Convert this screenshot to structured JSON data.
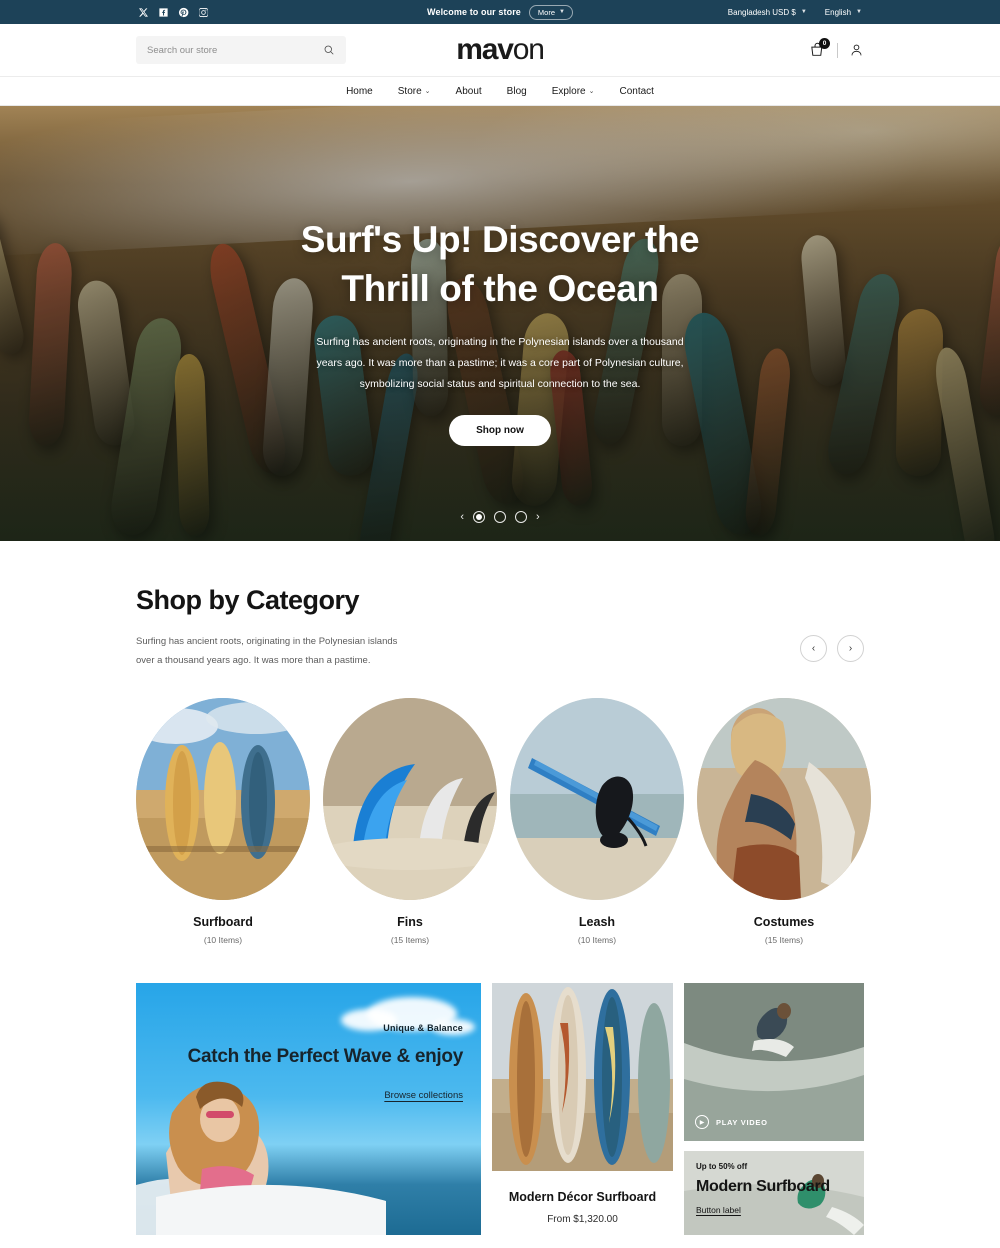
{
  "announcement": {
    "social_icons": [
      "x-twitter-icon",
      "facebook-icon",
      "pinterest-icon",
      "instagram-icon"
    ],
    "welcome_text": "Welcome to our store",
    "more_label": "More",
    "currency": "Bangladesh USD $",
    "language": "English"
  },
  "header": {
    "search_placeholder": "Search our store",
    "search_value": "",
    "logo_bold": "mav",
    "logo_light": "on",
    "cart_count": "0"
  },
  "nav": {
    "items": [
      {
        "label": "Home",
        "has_dropdown": false
      },
      {
        "label": "Store",
        "has_dropdown": true
      },
      {
        "label": "About",
        "has_dropdown": false
      },
      {
        "label": "Blog",
        "has_dropdown": false
      },
      {
        "label": "Explore",
        "has_dropdown": true
      },
      {
        "label": "Contact",
        "has_dropdown": false
      }
    ]
  },
  "hero": {
    "title": "Surf's Up! Discover the Thrill of the Ocean",
    "subtitle": "Surfing has ancient roots, originating in the Polynesian islands over a thousand years ago. It was more than a pastime; it was a core part of Polynesian culture, symbolizing social status and spiritual connection to the sea.",
    "cta_label": "Shop now",
    "slides_total": 3,
    "active_slide": 1,
    "prev_icon": "chevron-left-icon",
    "next_icon": "chevron-right-icon"
  },
  "categories_section": {
    "title": "Shop by Category",
    "description": "Surfing has ancient roots, originating in the Polynesian islands over a thousand years ago. It was more than a pastime.",
    "prev_label": "‹",
    "next_label": "›",
    "items": [
      {
        "name": "Surfboard",
        "count": "(10 Items)"
      },
      {
        "name": "Fins",
        "count": "(15 Items)"
      },
      {
        "name": "Leash",
        "count": "(10 Items)"
      },
      {
        "name": "Costumes",
        "count": "(15 Items)"
      }
    ]
  },
  "promos": {
    "wave": {
      "kicker": "Unique & Balance",
      "heading": "Catch the Perfect Wave & enjoy",
      "link_label": "Browse collections"
    },
    "product": {
      "title": "Modern Décor Surfboard",
      "price": "From $1,320.00"
    },
    "video": {
      "play_label": "PLAY VIDEO",
      "play_icon": "play-circle-icon"
    },
    "sale": {
      "kicker": "Up to 50% off",
      "title": "Modern Surfboard",
      "link_label": "Button label"
    }
  },
  "colors": {
    "announcement_bg": "#1d4258",
    "text_dark": "#141414",
    "muted": "#6a6a6a",
    "sky": "#27a5e8"
  }
}
